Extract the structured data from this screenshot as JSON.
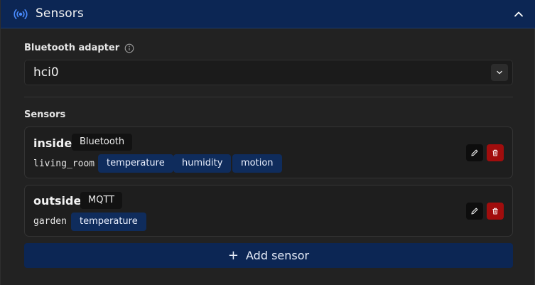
{
  "header": {
    "title": "Sensors",
    "icon": "radio-signal-icon",
    "collapse_icon": "chevron-up-icon"
  },
  "adapter": {
    "label": "Bluetooth adapter",
    "info_icon": "info-icon",
    "selected": "hci0"
  },
  "sensors_section": {
    "label": "Sensors",
    "items": [
      {
        "name": "inside",
        "type": "Bluetooth",
        "location": "living_room",
        "tags": [
          "temperature",
          "humidity",
          "motion"
        ]
      },
      {
        "name": "outside",
        "type": "MQTT",
        "location": "garden",
        "tags": [
          "temperature"
        ]
      }
    ]
  },
  "add_button": {
    "label": "Add sensor",
    "icon": "plus-icon"
  },
  "colors": {
    "header_bg": "#0c2654",
    "tag_bg": "#0f2c5c",
    "delete_bg": "#a10d0d",
    "accent_icon": "#4a8cff"
  }
}
